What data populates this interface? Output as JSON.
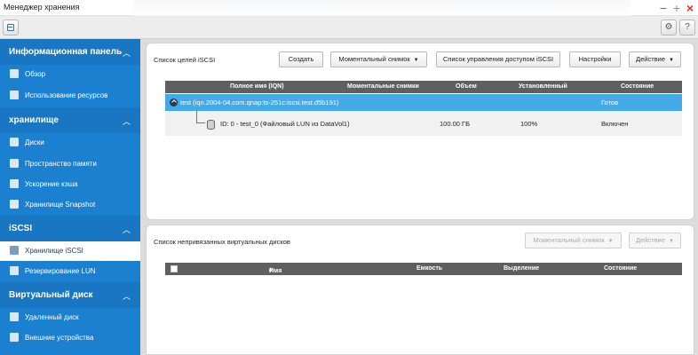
{
  "window": {
    "title": "Менеджер хранения"
  },
  "sidebar": {
    "sections": [
      {
        "label": "Информационная панель",
        "items": [
          {
            "label": "Обзор",
            "icon": "overview-icon"
          },
          {
            "label": "Использование ресурсов",
            "icon": "chart-icon"
          }
        ]
      },
      {
        "label": "хранилище",
        "items": [
          {
            "label": "Диски",
            "icon": "disk-icon"
          },
          {
            "label": "Пространство памяти",
            "icon": "storage-space-icon"
          },
          {
            "label": "Ускорение кэша",
            "icon": "cache-icon"
          },
          {
            "label": "Хранилище Snapshot",
            "icon": "snapshot-icon"
          }
        ]
      },
      {
        "label": "iSCSI",
        "items": [
          {
            "label": "Хранилище iSCSI",
            "icon": "iscsi-storage-icon",
            "active": true
          },
          {
            "label": "Резервирование LUN",
            "icon": "lun-backup-icon"
          }
        ]
      },
      {
        "label": "Виртуальный диск",
        "items": [
          {
            "label": "Удаленный диск",
            "icon": "remote-disk-icon"
          },
          {
            "label": "Внешние устройства",
            "icon": "external-device-icon"
          }
        ]
      }
    ]
  },
  "targets_panel": {
    "title": "Список целей iSCSI",
    "buttons": {
      "create": "Создать",
      "snapshot": "Моментальный снимок",
      "acl": "Список управления доступом iSCSI",
      "settings": "Настройки",
      "action": "Действие"
    },
    "columns": [
      "Полное имя (IQN)",
      "Моментальные снимки",
      "Объем",
      "Установленный",
      "Состояние"
    ],
    "target_row": {
      "name": "test (iqn.2004-04.com.qnap:ts-251c:iscsi.test.d5b191)",
      "status": "Готов"
    },
    "lun_row": {
      "name": "ID: 0 - test_0 (Файловый LUN из DataVol1)",
      "capacity": "100.00 ГБ",
      "allocated": "100%",
      "status": "Включен"
    }
  },
  "unmapped_panel": {
    "title": "Список непривязанных виртуальных дисков",
    "buttons": {
      "snapshot": "Моментальный снимок",
      "action": "Действие"
    },
    "columns": [
      "Имя",
      "Емкость",
      "Выделение",
      "Состояние"
    ]
  },
  "colors": {
    "sidebar": "#1a80cf",
    "selected_row": "#44aae7",
    "table_header": "#5f5f5f"
  }
}
